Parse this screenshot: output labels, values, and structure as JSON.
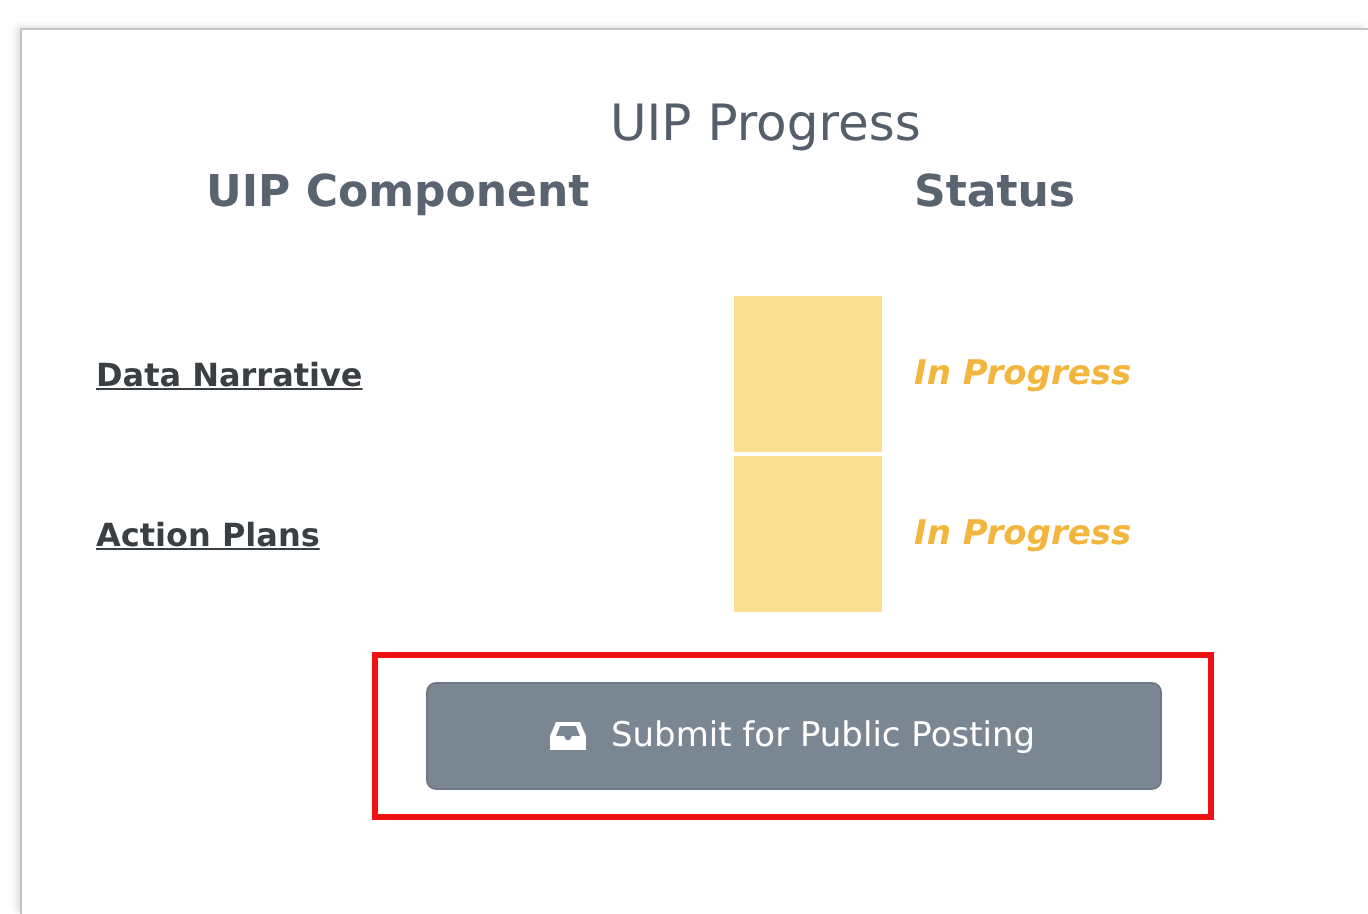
{
  "title": "UIP Progress",
  "columns": [
    "UIP Component",
    "Status"
  ],
  "rows": [
    {
      "component": "Data Narrative",
      "status": "In Progress",
      "color": "#f9df92"
    },
    {
      "component": "Action Plans",
      "status": "In Progress",
      "color": "#f9df92"
    }
  ],
  "submit_button": {
    "label": "Submit for Public Posting",
    "highlighted": true
  }
}
